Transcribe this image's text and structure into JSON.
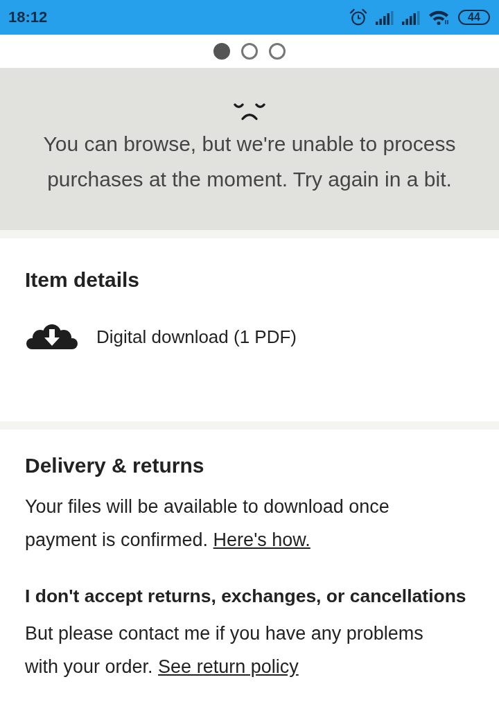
{
  "status_bar": {
    "time": "18:12",
    "battery": "44"
  },
  "pager": {
    "pages": [
      {
        "selected": true
      },
      {
        "selected": false
      },
      {
        "selected": false
      }
    ]
  },
  "notice": {
    "text": "You can browse, but we're unable to process purchases at the moment. Try again in a bit."
  },
  "item_details": {
    "title": "Item details",
    "items": [
      {
        "label": "Digital download (1 PDF)"
      }
    ]
  },
  "delivery": {
    "title": "Delivery & returns",
    "text": "Your files will be available to download once payment is confirmed.",
    "link": "Here's how."
  },
  "returns": {
    "title": "I don't accept returns, exchanges, or cancellations",
    "text": "But please contact me if you have any problems with your order.",
    "link": "See return policy"
  }
}
